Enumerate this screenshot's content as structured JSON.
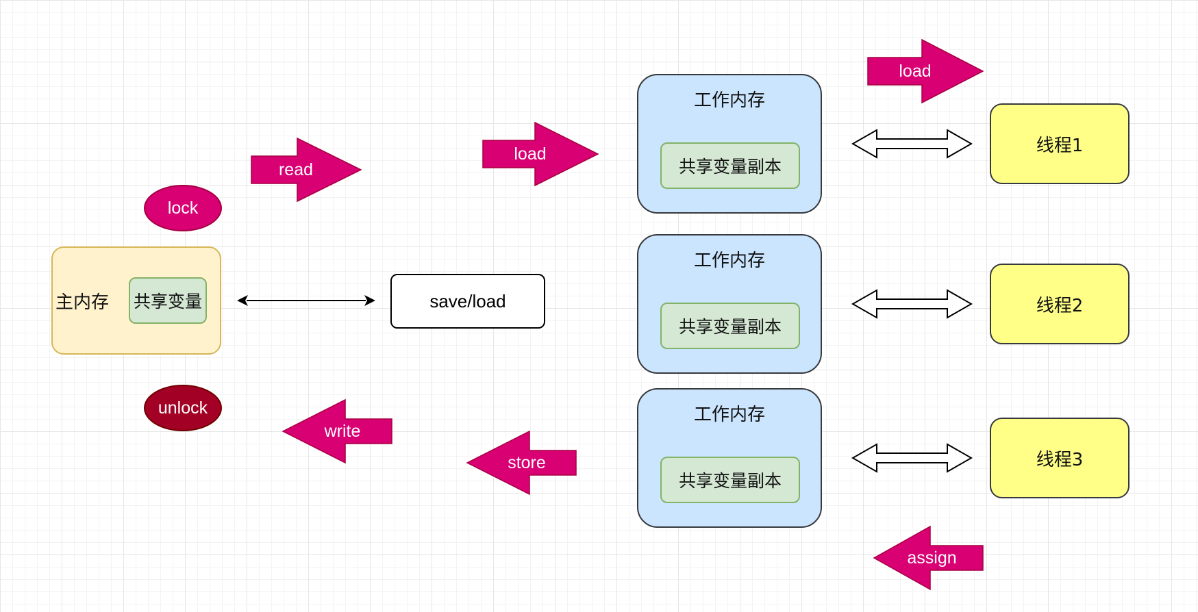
{
  "main_memory": {
    "label": "主内存",
    "shared_variable": "共享变量"
  },
  "operations": {
    "lock": "lock",
    "unlock": "unlock",
    "read": "read",
    "load_left": "load",
    "load_top": "load",
    "write": "write",
    "store": "store",
    "assign": "assign"
  },
  "save_load": "save/load",
  "work_memories": [
    {
      "title": "工作内存",
      "copy": "共享变量副本"
    },
    {
      "title": "工作内存",
      "copy": "共享变量副本"
    },
    {
      "title": "工作内存",
      "copy": "共享变量副本"
    }
  ],
  "threads": [
    {
      "label": "线程1"
    },
    {
      "label": "线程2"
    },
    {
      "label": "线程3"
    }
  ],
  "colors": {
    "op_arrow_fill": "#d80073",
    "op_arrow_stroke": "#a50040",
    "lock_fill": "#d80073",
    "unlock_fill": "#a20025",
    "main_memory_fill": "#fff2cc",
    "shared_var_fill": "#d5e8d4",
    "work_memory_fill": "#cce5ff",
    "thread_fill": "#ffff88"
  }
}
